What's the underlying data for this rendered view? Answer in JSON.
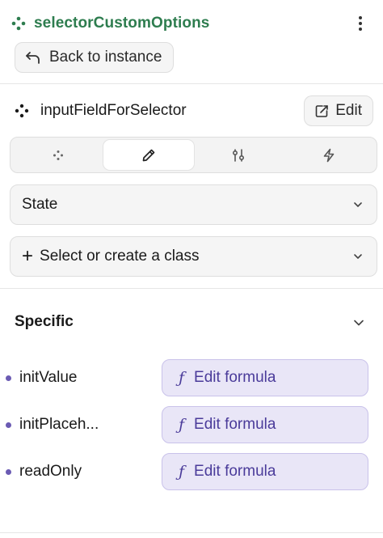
{
  "header": {
    "component_name": "selectorCustomOptions",
    "back_label": "Back to instance"
  },
  "element": {
    "name": "inputFieldForSelector",
    "edit_label": "Edit"
  },
  "tabs": [
    {
      "icon": "sparkle-icon",
      "active": false
    },
    {
      "icon": "pencil-icon",
      "active": true
    },
    {
      "icon": "sliders-icon",
      "active": false
    },
    {
      "icon": "lightning-icon",
      "active": false
    }
  ],
  "state_dropdown": {
    "label": "State"
  },
  "class_dropdown": {
    "label": "Select or create a class"
  },
  "specific": {
    "title": "Specific",
    "properties": [
      {
        "label": "initValue",
        "button": "Edit formula"
      },
      {
        "label": "initPlaceh...",
        "button": "Edit formula"
      },
      {
        "label": "readOnly",
        "button": "Edit formula"
      }
    ]
  },
  "colors": {
    "component_green": "#2e7d4f",
    "formula_bg": "#e9e6f7",
    "formula_text": "#4a3b9a",
    "bullet": "#6b5bb3"
  }
}
